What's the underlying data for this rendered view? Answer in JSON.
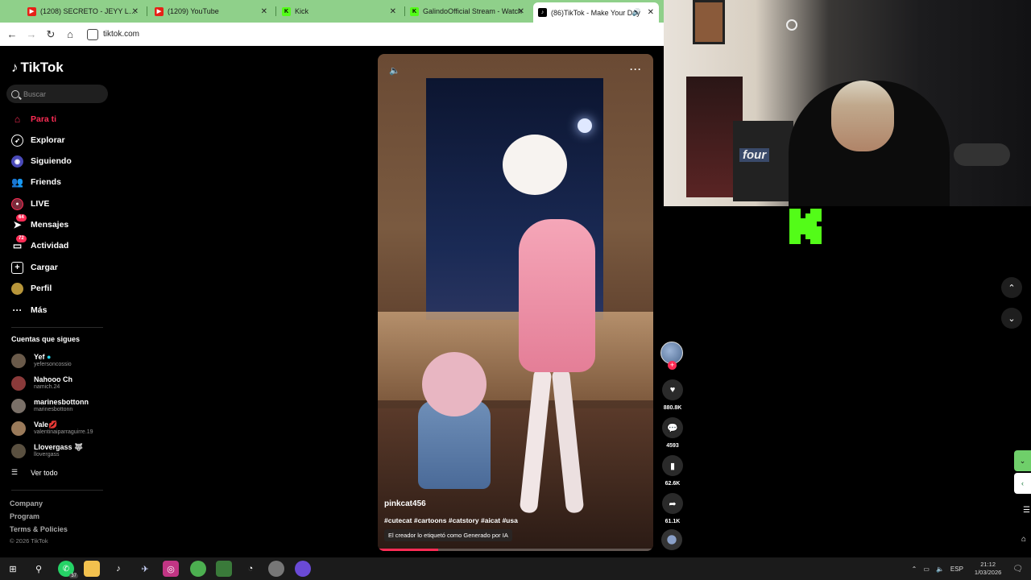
{
  "browser": {
    "tabs": [
      {
        "label": "(1208) SECRETO - JEYY LUCAS",
        "favicon": "youtube",
        "color": "#e62117"
      },
      {
        "label": "(1209) YouTube",
        "favicon": "youtube",
        "color": "#e62117"
      },
      {
        "label": "Kick",
        "favicon": "kick",
        "color": "#53fc18"
      },
      {
        "label": "GalindoOfficial Stream - Watch",
        "favicon": "kick",
        "color": "#53fc18"
      },
      {
        "label": "(86)TikTok - Make Your Day",
        "favicon": "tiktok",
        "color": "#000000"
      }
    ],
    "url": "tiktok.com"
  },
  "tiktok": {
    "brand": "TikTok",
    "search_placeholder": "Buscar",
    "nav": [
      {
        "label": "Para ti",
        "icon": "home-icon",
        "active": true
      },
      {
        "label": "Explorar",
        "icon": "compass-icon"
      },
      {
        "label": "Siguiendo",
        "icon": "following-icon"
      },
      {
        "label": "Friends",
        "icon": "friends-icon"
      },
      {
        "label": "LIVE",
        "icon": "live-icon"
      },
      {
        "label": "Mensajes",
        "icon": "messages-icon",
        "badge": "64"
      },
      {
        "label": "Actividad",
        "icon": "activity-icon",
        "badge": "72"
      },
      {
        "label": "Cargar",
        "icon": "upload-icon"
      },
      {
        "label": "Perfil",
        "icon": "profile-icon"
      },
      {
        "label": "Más",
        "icon": "more-icon"
      }
    ],
    "following_title": "Cuentas que sigues",
    "following": [
      {
        "name": "Yef",
        "handle": "yefersoncossio",
        "verified": true
      },
      {
        "name": "Nahooo Ch",
        "handle": "namich.24"
      },
      {
        "name": "marinesbottonn",
        "handle": "marinesbottonn"
      },
      {
        "name": "Vale💋",
        "handle": "valentinaiparraguirre.19"
      },
      {
        "name": "Llovergass 🐺",
        "handle": "llovergass"
      }
    ],
    "see_all": "Ver todo",
    "footer": [
      "Company",
      "Program",
      "Terms & Policies"
    ],
    "copyright": "© 2026 TikTok",
    "video": {
      "author": "pinkcat456",
      "tags": "#cutecat #cartoons #catstory #aicat #usa",
      "ai_label": "El creador lo etiquetó como Generado por IA",
      "progress": 0.22
    },
    "stats": {
      "likes": "880.8K",
      "comments": "4593",
      "saves": "62.6K",
      "shares": "61.1K"
    }
  },
  "stream": {
    "overlay_logo": "four"
  },
  "taskbar": {
    "whatsapp_badge": "37",
    "lang": "ESP",
    "time": "21:12",
    "date": "1/03/2026"
  }
}
